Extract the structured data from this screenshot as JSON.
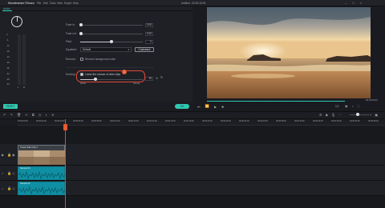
{
  "app": {
    "name": "Wondershare Filmora",
    "doc_title": "Untitled : 00:00:10:00"
  },
  "menu": [
    "File",
    "Edit",
    "Tools",
    "View",
    "Export",
    "Help"
  ],
  "window_controls": [
    "–",
    "□",
    "×"
  ],
  "tabs": [
    {
      "label": "Audio"
    }
  ],
  "audio": {
    "meter_labels": [
      "0",
      "-6",
      "-12",
      "-18",
      "-24",
      "-30",
      "-36",
      "-42",
      "-48",
      "-54"
    ],
    "meter_lr": [
      "L",
      "R"
    ],
    "fade_in": {
      "label": "Fade in:",
      "value": "0.00",
      "fraction": 0.0
    },
    "fade_out": {
      "label": "Fade out:",
      "value": "0.00",
      "fraction": 0.0
    },
    "pitch": {
      "label": "Pitch:",
      "value": "0",
      "fraction": 0.5
    },
    "equalizer": {
      "label": "Equalizer:",
      "selected": "Default",
      "customize_label": "Customize"
    },
    "denoise": {
      "label": "Remove:",
      "option": "Remove background noise"
    },
    "ducking": {
      "label": "Ducking:",
      "option": "Lower the volume of other clips",
      "value": "25",
      "unit": "%",
      "fraction": 0.25,
      "min_label": "Weak",
      "max_label": "Strong"
    },
    "badge": "1"
  },
  "buttons": {
    "reset": "RESET",
    "ok": "OK"
  },
  "player": {
    "timecode": "00:00:00:00",
    "ratio": "1/2",
    "progress": 1.0
  },
  "timeline": {
    "ruler_ticks": [
      "00:00:00:00",
      "00:00:02:00",
      "00:00:04:00",
      "00:00:06:00",
      "00:00:08:00",
      "00:00:10:00",
      "00:00:12:00",
      "00:00:14:00",
      "00:00:16:00",
      "00:00:18:00",
      "00:00:20:00",
      "00:00:22:00",
      "00:00:24:00",
      "00:00:26:00",
      "00:00:28:00",
      "00:00:30:00",
      "00:00:32:00",
      "00:00:34:00",
      "00:00:36:00",
      "00:00:38:00"
    ],
    "video_clip_label": "Travel Video Clip 2",
    "audio_clip_1": "Sample 04",
    "audio_clip_2": "Sample 04"
  },
  "colors": {
    "accent": "#31c8b1",
    "playhead": "#e0483a",
    "clip_audio": "#0f8fa3"
  }
}
